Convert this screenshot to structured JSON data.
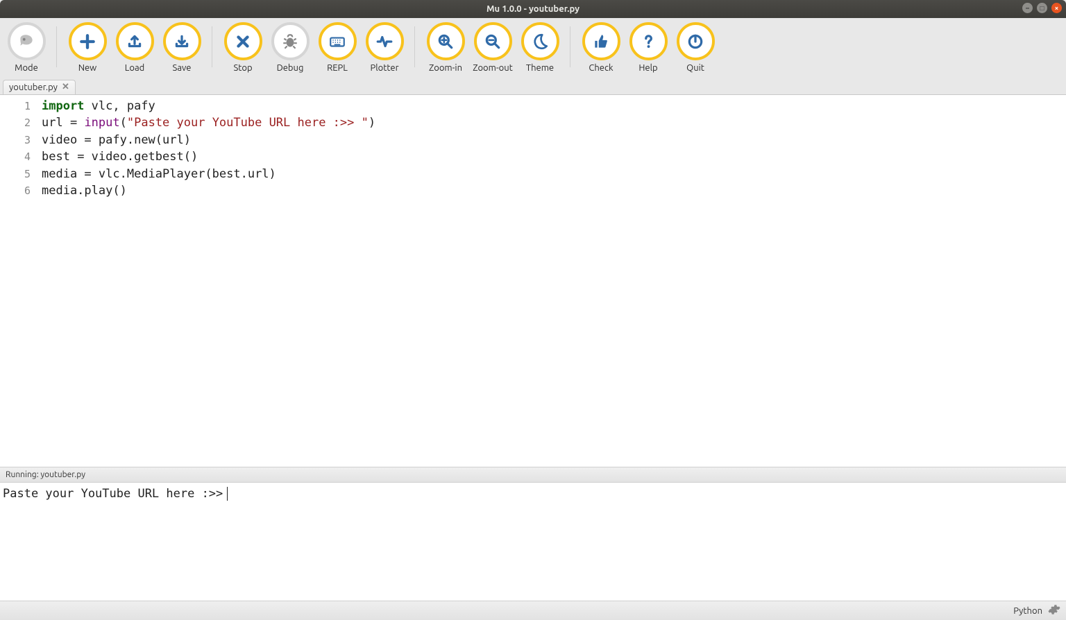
{
  "window": {
    "title": "Mu 1.0.0 - youtuber.py"
  },
  "toolbar": {
    "groups": [
      {
        "items": [
          {
            "id": "mode",
            "label": "Mode",
            "icon": "mode",
            "grey": true
          }
        ]
      },
      {
        "items": [
          {
            "id": "new",
            "label": "New",
            "icon": "plus"
          },
          {
            "id": "load",
            "label": "Load",
            "icon": "upload"
          },
          {
            "id": "save",
            "label": "Save",
            "icon": "download"
          }
        ]
      },
      {
        "items": [
          {
            "id": "stop",
            "label": "Stop",
            "icon": "x"
          },
          {
            "id": "debug",
            "label": "Debug",
            "icon": "bug",
            "grey": true
          },
          {
            "id": "repl",
            "label": "REPL",
            "icon": "keyboard"
          },
          {
            "id": "plotter",
            "label": "Plotter",
            "icon": "pulse"
          }
        ]
      },
      {
        "items": [
          {
            "id": "zoom-in",
            "label": "Zoom-in",
            "icon": "zoom-in"
          },
          {
            "id": "zoom-out",
            "label": "Zoom-out",
            "icon": "zoom-out"
          },
          {
            "id": "theme",
            "label": "Theme",
            "icon": "moon"
          }
        ]
      },
      {
        "items": [
          {
            "id": "check",
            "label": "Check",
            "icon": "thumbs-up"
          },
          {
            "id": "help",
            "label": "Help",
            "icon": "question"
          },
          {
            "id": "quit",
            "label": "Quit",
            "icon": "power"
          }
        ]
      }
    ]
  },
  "tabs": [
    {
      "label": "youtuber.py"
    }
  ],
  "editor": {
    "language": "python",
    "lines": [
      [
        {
          "t": "import ",
          "c": "keyword"
        },
        {
          "t": "vlc, pafy",
          "c": "plain"
        }
      ],
      [
        {
          "t": "url ",
          "c": "plain"
        },
        {
          "t": "= ",
          "c": "punc"
        },
        {
          "t": "input",
          "c": "builtin"
        },
        {
          "t": "(",
          "c": "punc"
        },
        {
          "t": "\"Paste your YouTube URL here :>> \"",
          "c": "string"
        },
        {
          "t": ")",
          "c": "punc"
        }
      ],
      [
        {
          "t": "video ",
          "c": "plain"
        },
        {
          "t": "= ",
          "c": "punc"
        },
        {
          "t": "pafy.new(url)",
          "c": "plain"
        }
      ],
      [
        {
          "t": "best ",
          "c": "plain"
        },
        {
          "t": "= ",
          "c": "punc"
        },
        {
          "t": "video.getbest()",
          "c": "plain"
        }
      ],
      [
        {
          "t": "media ",
          "c": "plain"
        },
        {
          "t": "= ",
          "c": "punc"
        },
        {
          "t": "vlc.MediaPlayer(best.url)",
          "c": "plain"
        }
      ],
      [
        {
          "t": "media.play()",
          "c": "plain"
        }
      ]
    ]
  },
  "runner": {
    "header": "Running: youtuber.py",
    "output": "Paste your YouTube URL here :>> "
  },
  "status": {
    "mode": "Python"
  }
}
